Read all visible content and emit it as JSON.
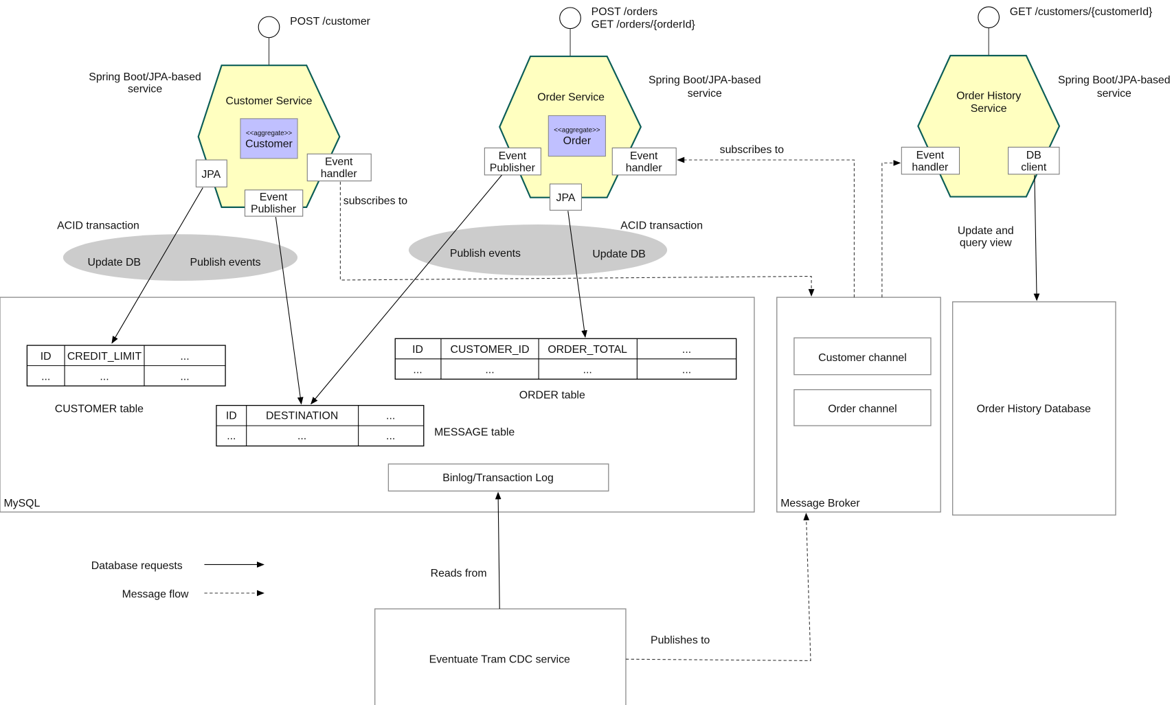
{
  "diagram": {
    "services": [
      {
        "name": "Customer Service",
        "aggregate_stereotype": "<<aggregate>>",
        "aggregate_name": "Customer",
        "api": [
          "POST /customer"
        ],
        "note": [
          "Spring Boot/JPA-based",
          "service"
        ],
        "ports": {
          "jpa": "JPA",
          "publisher": [
            "Event",
            "Publisher"
          ],
          "handler": [
            "Event",
            "handler"
          ]
        }
      },
      {
        "name": "Order Service",
        "aggregate_stereotype": "<<aggregate>>",
        "aggregate_name": "Order",
        "api": [
          "POST /orders",
          "GET /orders/{orderId}"
        ],
        "note": [
          "Spring Boot/JPA-based",
          "service"
        ],
        "ports": {
          "jpa": "JPA",
          "publisher": [
            "Event",
            "Publisher"
          ],
          "handler": [
            "Event",
            "handler"
          ]
        }
      },
      {
        "name": [
          "Order History",
          "Service"
        ],
        "api": [
          "GET /customers/{customerId}"
        ],
        "note": [
          "Spring Boot/JPA-based",
          "service"
        ],
        "ports": {
          "handler": [
            "Event",
            "handler"
          ],
          "db_client": [
            "DB",
            "client"
          ]
        }
      }
    ],
    "transactions": [
      {
        "label": "ACID transaction",
        "left": "Update DB",
        "right": "Publish events"
      },
      {
        "label": "ACID transaction",
        "left": "Publish events",
        "right": "Update DB"
      }
    ],
    "edge_labels": {
      "subscribes_to_1": "subscribes to",
      "subscribes_to_2": "subscribes to",
      "update_query": [
        "Update and",
        "query view"
      ],
      "reads_from": "Reads from",
      "publishes_to": "Publishes to"
    },
    "mysql": {
      "label": "MySQL",
      "tables": {
        "customer": {
          "caption": "CUSTOMER table",
          "headers": [
            "ID",
            "CREDIT_LIMIT",
            "..."
          ],
          "row": [
            "...",
            "...",
            "..."
          ]
        },
        "message": {
          "caption": "MESSAGE table",
          "headers": [
            "ID",
            "DESTINATION",
            "..."
          ],
          "row": [
            "...",
            "...",
            "..."
          ]
        },
        "order": {
          "caption": "ORDER table",
          "headers": [
            "ID",
            "CUSTOMER_ID",
            "ORDER_TOTAL",
            "..."
          ],
          "row": [
            "...",
            "...",
            "...",
            "..."
          ]
        }
      },
      "binlog": "Binlog/Transaction Log"
    },
    "broker": {
      "label": "Message Broker",
      "channels": [
        "Customer channel",
        "Order channel"
      ]
    },
    "order_history_db": "Order History Database",
    "cdc_service": "Eventuate Tram CDC service",
    "legend": {
      "database_requests": "Database requests",
      "message_flow": "Message flow"
    }
  }
}
